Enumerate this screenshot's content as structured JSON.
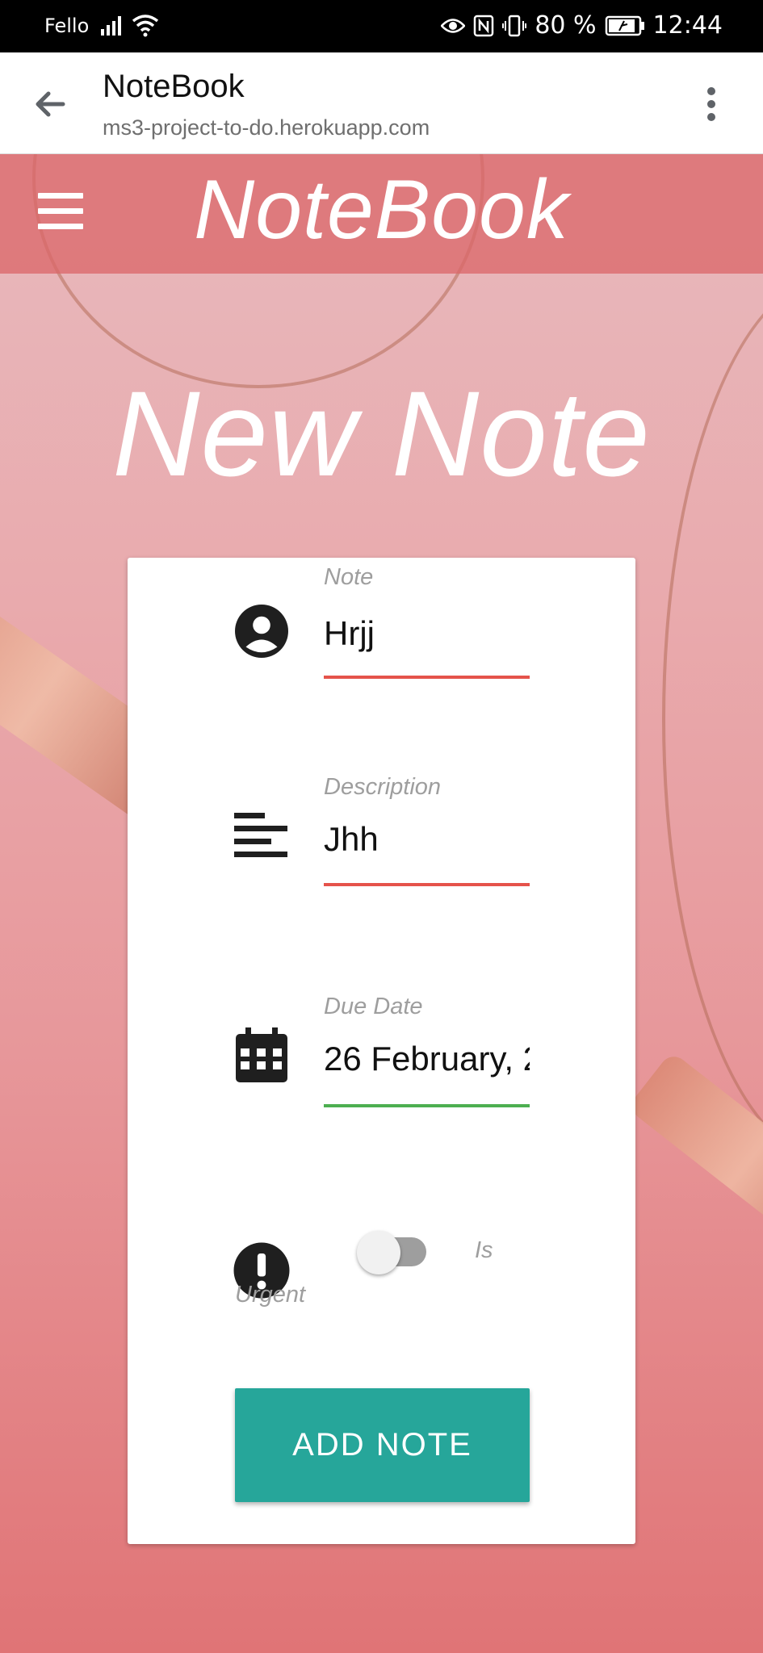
{
  "status_bar": {
    "carrier": "Fello",
    "battery": "80 %",
    "time": "12:44"
  },
  "browser": {
    "page_title": "NoteBook",
    "url": "ms3-project-to-do.herokuapp.com"
  },
  "navbar": {
    "brand": "NoteBook"
  },
  "page": {
    "heading": "New Note"
  },
  "form": {
    "note": {
      "label": "Note",
      "value": "Hrjj",
      "icon": "account-circle-icon"
    },
    "description": {
      "label": "Description",
      "value": "Jhh",
      "icon": "subject-icon"
    },
    "due_date": {
      "label": "Due Date",
      "value": "26 February, 2",
      "icon": "calendar-icon"
    },
    "urgent": {
      "label_part1": "Is",
      "label_part2": "Urgent",
      "checked": false,
      "icon": "priority-high-icon"
    },
    "submit_label": "ADD NOTE"
  },
  "colors": {
    "accent_invalid": "#e5534b",
    "accent_valid": "#4caf50",
    "button": "#26a69a"
  }
}
